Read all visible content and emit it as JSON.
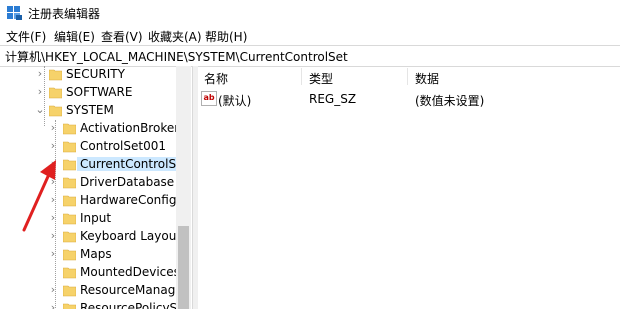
{
  "window": {
    "title": "注册表编辑器"
  },
  "menu": [
    {
      "label": "文件(F)"
    },
    {
      "label": "编辑(E)"
    },
    {
      "label": "查看(V)"
    },
    {
      "label": "收藏夹(A)"
    },
    {
      "label": "帮助(H)"
    }
  ],
  "address": "计算机\\HKEY_LOCAL_MACHINE\\SYSTEM\\CurrentControlSet",
  "tree": [
    {
      "label": "SECURITY",
      "indent": 0,
      "expanded": false,
      "selected": false
    },
    {
      "label": "SOFTWARE",
      "indent": 0,
      "expanded": false,
      "selected": false
    },
    {
      "label": "SYSTEM",
      "indent": 0,
      "expanded": true,
      "selected": false
    },
    {
      "label": "ActivationBroker",
      "indent": 1,
      "expanded": false,
      "selected": false
    },
    {
      "label": "ControlSet001",
      "indent": 1,
      "expanded": false,
      "selected": false
    },
    {
      "label": "CurrentControlSet",
      "indent": 1,
      "expanded": false,
      "selected": true
    },
    {
      "label": "DriverDatabase",
      "indent": 1,
      "expanded": false,
      "selected": false
    },
    {
      "label": "HardwareConfig",
      "indent": 1,
      "expanded": false,
      "selected": false
    },
    {
      "label": "Input",
      "indent": 1,
      "expanded": false,
      "selected": false
    },
    {
      "label": "Keyboard Layout",
      "indent": 1,
      "expanded": false,
      "selected": false
    },
    {
      "label": "Maps",
      "indent": 1,
      "expanded": false,
      "selected": false
    },
    {
      "label": "MountedDevices",
      "indent": 1,
      "expanded": false,
      "selected": false
    },
    {
      "label": "ResourceManager",
      "indent": 1,
      "expanded": false,
      "selected": false
    },
    {
      "label": "ResourcePolicySto",
      "indent": 1,
      "expanded": false,
      "selected": false
    }
  ],
  "columns": {
    "name": "名称",
    "type": "类型",
    "data": "数据"
  },
  "values": [
    {
      "icon": "string-value-icon",
      "badge": "ab",
      "name": "(默认)",
      "type": "REG_SZ",
      "data": "(数值未设置)"
    }
  ],
  "colors": {
    "selection": "#cce8ff",
    "arrow": "#e02020",
    "folder": "#f6d26a"
  }
}
